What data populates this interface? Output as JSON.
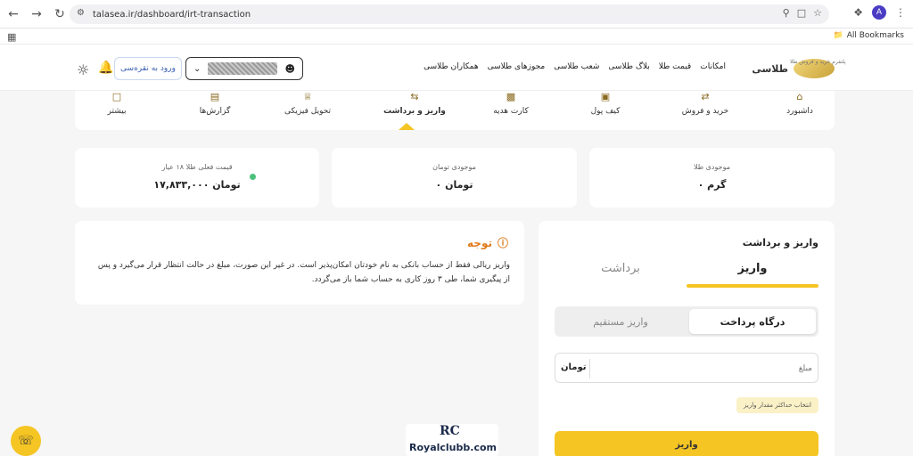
{
  "browser": {
    "url": "talasea.ir/dashboard/irt-transaction",
    "avatar_letter": "A",
    "all_bookmarks": "All Bookmarks"
  },
  "site": {
    "logo_name": "طلاسی",
    "logo_tagline": "پلتفرم خرید و فروش طلا",
    "nav": [
      "امکانات",
      "قیمت طلا",
      "بلاگ طلاسی",
      "شعب طلاسی",
      "مجوزهای طلاسی",
      "همکاران طلاسی"
    ],
    "login_label": "ورود به نقره‌سی"
  },
  "tabs": [
    {
      "label": "داشبورد",
      "icon": "home-icon"
    },
    {
      "label": "خرید و فروش",
      "icon": "trade-icon"
    },
    {
      "label": "کیف پول",
      "icon": "wallet-icon"
    },
    {
      "label": "کارت هدیه",
      "icon": "gift-card-icon"
    },
    {
      "label": "واریز و برداشت",
      "icon": "transfer-icon"
    },
    {
      "label": "تحویل فیزیکی",
      "icon": "delivery-icon"
    },
    {
      "label": "گزارش‌ها",
      "icon": "report-icon"
    },
    {
      "label": "بیشتر",
      "icon": "more-icon"
    }
  ],
  "stats": {
    "gold_label": "موجودی طلا",
    "gold_value": "۰ گرم",
    "toman_label": "موجودی تومان",
    "toman_value": "۰ تومان",
    "price_label": "قیمت فعلی طلا ۱۸ عیار",
    "price_value": "۱۷,۸۳۳,۰۰۰ تومان"
  },
  "notice": {
    "title": "توجه",
    "text": "واریز ریالی فقط از حساب بانکی به نام خودتان امکان‌پذیر است. در غیر این صورت، مبلغ در حالت انتظار قرار می‌گیرد و پس از پیگیری شما، طی ۳ روز کاری به حساب شما باز می‌گردد."
  },
  "panel": {
    "title": "واریز و برداشت",
    "tab_deposit": "واریز",
    "tab_withdraw": "برداشت",
    "seg_gateway": "درگاه پرداخت",
    "seg_direct": "واریز مستقیم",
    "amount_placeholder": "مبلغ",
    "amount_unit": "تومان",
    "max_chip": "انتخاب حداکثر مقدار واریز",
    "submit_label": "واریز"
  },
  "watermark": {
    "mark": "RC",
    "text": "Royalclubb.com"
  },
  "colors": {
    "accent": "#f5c524",
    "notice": "#e07a1a",
    "online": "#4cc17b"
  }
}
